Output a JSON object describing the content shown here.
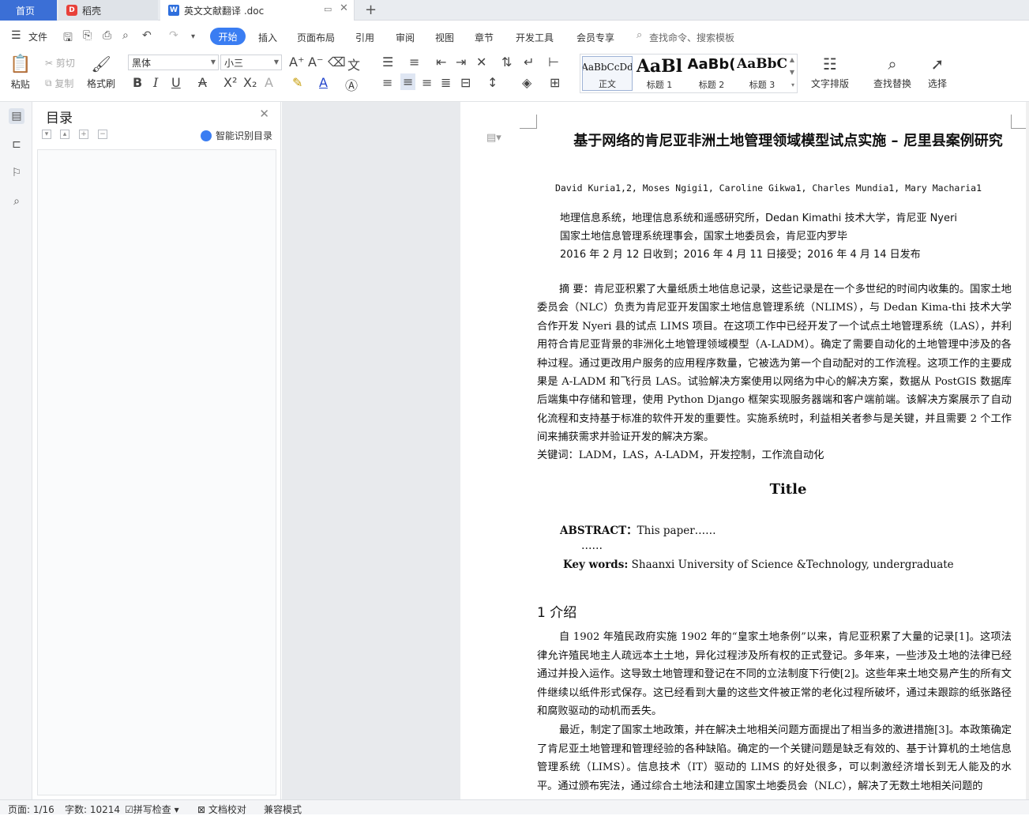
{
  "tabs": {
    "home": "首页",
    "daoke": "稻壳",
    "document": "英文文献翻译 .doc"
  },
  "menu": {
    "file": "文件",
    "items": [
      "开始",
      "插入",
      "页面布局",
      "引用",
      "审阅",
      "视图",
      "章节",
      "开发工具",
      "会员专享"
    ],
    "search_placeholder": "查找命令、搜索模板"
  },
  "ribbon": {
    "paste": "粘贴",
    "cut": "剪切",
    "copy": "复制",
    "format_painter": "格式刷",
    "font_name": "黑体",
    "font_size": "小三",
    "styles": [
      {
        "sample": "AaBbCcDd",
        "label": "正文"
      },
      {
        "sample": "AaBl",
        "label": "标题 1"
      },
      {
        "sample": "AaBb(",
        "label": "标题 2"
      },
      {
        "sample": "AaBbC",
        "label": "标题 3"
      }
    ],
    "text_layout": "文字排版",
    "find_replace": "查找替换",
    "select": "选择"
  },
  "toc": {
    "title": "目录",
    "smart_detect": "智能识别目录"
  },
  "document": {
    "title": "基于网络的肯尼亚非洲土地管理领域模型试点实施 – 尼里县案例研究",
    "authors": "David Kuria1,2, Moses Ngigi1, Caroline Gikwa1, Charles Mundia1, Mary Macharia1",
    "affiliation1": "地理信息系统，地理信息系统和遥感研究所，Dedan Kimathi 技术大学，肯尼亚 Nyeri",
    "affiliation2": "国家土地信息管理系统理事会，国家土地委员会，肯尼亚内罗毕",
    "dates": "2016 年 2 月 12 日收到；2016 年 4 月 11 日接受；2016 年 4 月 14 日发布",
    "abstract": "摘 要：肯尼亚积累了大量纸质土地信息记录，这些记录是在一个多世纪的时间内收集的。国家土地委员会（NLC）负责为肯尼亚开发国家土地信息管理系统（NLIMS），与 Dedan Kima-thi 技术大学合作开发 Nyeri 县的试点 LIMS 项目。在这项工作中已经开发了一个试点土地管理系统（LAS），并利用符合肯尼亚背景的非洲化土地管理领域模型（A-LADM）。确定了需要自动化的土地管理中涉及的各种过程。通过更改用户服务的应用程序数量，它被选为第一个自动配对的工作流程。这项工作的主要成果是 A-LADM 和飞行员 LAS。试验解决方案使用以网络为中心的解决方案，数据从 PostGIS 数据库后端集中存储和管理，使用 Python Django 框架实现服务器端和客户端前端。该解决方案展示了自动化流程和支持基于标准的软件开发的重要性。实施系统时，利益相关者参与是关键，并且需要 2 个工作间来捕获需求并验证开发的解决方案。",
    "keywords": "关键词：LADM，LAS，A-LADM，开发控制，工作流自动化",
    "en_title": "Title",
    "en_abstract_label": "ABSTRACT：",
    "en_abstract_text": "This paper……",
    "en_dots": "……",
    "en_keywords_label": "Key words:",
    "en_keywords_text": "Shaanxi University of Science &Technology, undergraduate",
    "section1": "1  介绍",
    "para1": "自 1902 年殖民政府实施 1902 年的“皇家土地条例”以来，肯尼亚积累了大量的记录[1]。这项法律允许殖民地主人疏远本土土地，异化过程涉及所有权的正式登记。多年来，一些涉及土地的法律已经通过并投入运作。这导致土地管理和登记在不同的立法制度下行使[2]。这些年来土地交易产生的所有文件继续以纸件形式保存。这已经看到大量的这些文件被正常的老化过程所破坏，通过未跟踪的纸张路径和腐败驱动的动机而丢失。",
    "para2": "最近，制定了国家土地政策，并在解决土地相关问题方面提出了相当多的激进措施[3]。本政策确定了肯尼亚土地管理和管理经验的各种缺陷。确定的一个关键问题是缺乏有效的、基于计算机的土地信息管理系统（LIMS）。信息技术（IT）驱动的 LIMS 的好处很多，可以刺激经济增长到无人能及的水平。通过颁布宪法，通过综合土地法和建立国家土地委员会（NLC），解决了无数土地相关问题的"
  },
  "status": {
    "page": "页面: 1/16",
    "words": "字数: 10214",
    "spell": "拼写检查",
    "proof": "文档校对",
    "compat": "兼容模式"
  },
  "colors": {
    "accent": "#3a7df2",
    "home_tab": "#3b6fd6"
  }
}
